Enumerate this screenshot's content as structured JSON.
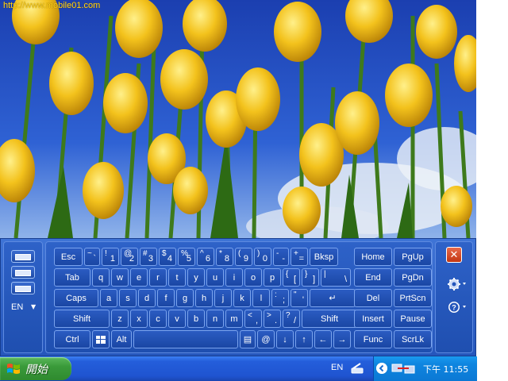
{
  "watermark": "http://www.mobile01.com",
  "language": "EN",
  "keyboard": {
    "rows": [
      [
        {
          "label": "Esc"
        },
        {
          "sub": "~",
          "main": "`"
        },
        {
          "sub": "!",
          "main": "1"
        },
        {
          "sub": "@",
          "main": "2"
        },
        {
          "sub": "#",
          "main": "3"
        },
        {
          "sub": "$",
          "main": "4"
        },
        {
          "sub": "%",
          "main": "5"
        },
        {
          "sub": "^",
          "main": "6"
        },
        {
          "sub": "*",
          "main": "8"
        },
        {
          "sub": "(",
          "main": "9"
        },
        {
          "sub": ")",
          "main": "0"
        },
        {
          "sub": "-",
          "main": "-"
        },
        {
          "sub": "+",
          "main": "="
        },
        {
          "label": "Bksp"
        }
      ],
      [
        {
          "label": "Tab"
        },
        {
          "label": "q"
        },
        {
          "label": "w"
        },
        {
          "label": "e"
        },
        {
          "label": "r"
        },
        {
          "label": "t"
        },
        {
          "label": "y"
        },
        {
          "label": "u"
        },
        {
          "label": "i"
        },
        {
          "label": "o"
        },
        {
          "label": "p"
        },
        {
          "sub": "{",
          "main": "["
        },
        {
          "sub": "}",
          "main": "]"
        },
        {
          "sub": "|",
          "main": "\\"
        }
      ],
      [
        {
          "label": "Caps"
        },
        {
          "label": "a"
        },
        {
          "label": "s"
        },
        {
          "label": "d"
        },
        {
          "label": "f"
        },
        {
          "label": "g"
        },
        {
          "label": "h"
        },
        {
          "label": "j"
        },
        {
          "label": "k"
        },
        {
          "label": "l"
        },
        {
          "sub": ":",
          "main": ";"
        },
        {
          "sub": "\"",
          "main": "'"
        },
        {
          "label": "↵"
        }
      ],
      [
        {
          "label": "Shift"
        },
        {
          "label": "z"
        },
        {
          "label": "x"
        },
        {
          "label": "c"
        },
        {
          "label": "v"
        },
        {
          "label": "b"
        },
        {
          "label": "n"
        },
        {
          "label": "m"
        },
        {
          "sub": "<",
          "main": ","
        },
        {
          "sub": ">",
          "main": "."
        },
        {
          "sub": "?",
          "main": "/"
        },
        {
          "label": "Shift"
        }
      ],
      [
        {
          "label": "Ctrl"
        },
        {
          "label": "",
          "icon": "windows-logo-icon"
        },
        {
          "label": "Alt"
        },
        {
          "label": ""
        },
        {
          "label": "▤",
          "icon": "context-menu-icon"
        },
        {
          "label": "@"
        },
        {
          "label": "↓"
        },
        {
          "label": "↑"
        },
        {
          "label": "←"
        },
        {
          "label": "→"
        }
      ]
    ],
    "nav": [
      [
        "Home",
        "PgUp"
      ],
      [
        "End",
        "PgDn"
      ],
      [
        "Del",
        "PrtScn"
      ],
      [
        "Insert",
        "Pause"
      ],
      [
        "Func",
        "ScrLk"
      ]
    ]
  },
  "taskbar": {
    "start_label": "開始",
    "tray_lang": "EN",
    "clock": "下午 11:55"
  },
  "colors": {
    "panel": "#2556bb",
    "key": "#1a47a4",
    "key_border": "#7aa3ee",
    "taskbar": "#245edb",
    "start": "#3a9a3a",
    "tray": "#0f86e0"
  }
}
